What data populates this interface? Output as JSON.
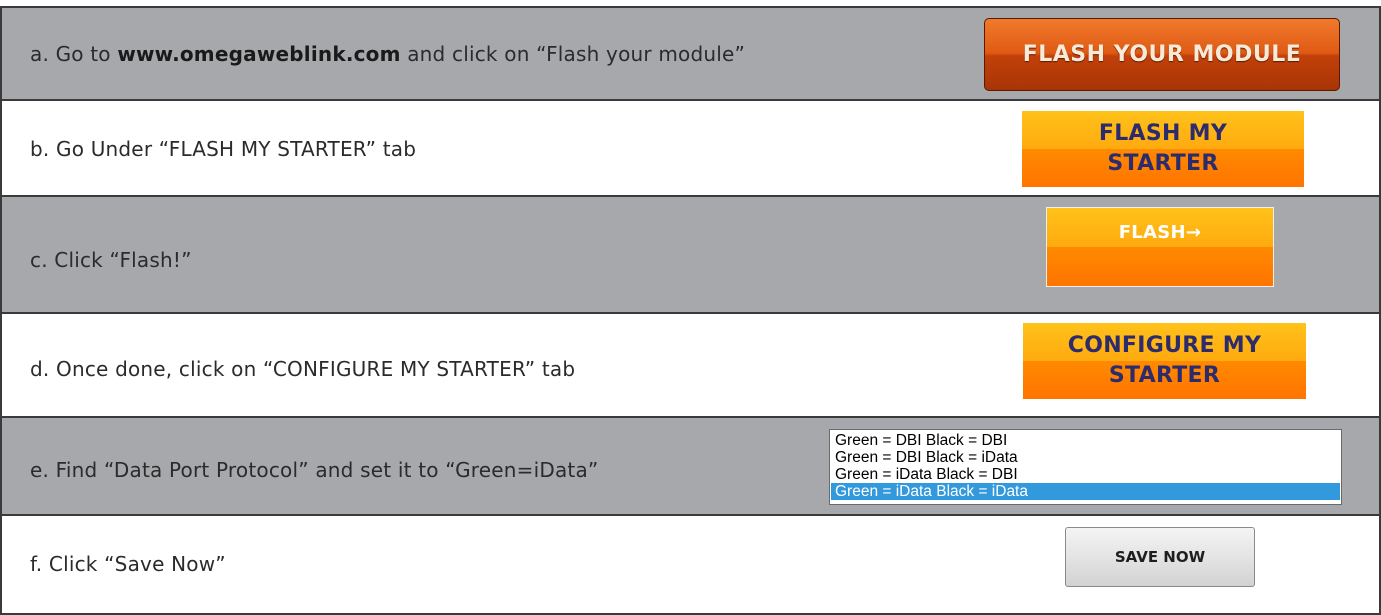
{
  "steps": [
    {
      "prefix": "a. Go to ",
      "bold": "www.omegaweblink.com",
      "suffix": " and click on “Flash your module”",
      "button": "FLASH YOUR MODULE"
    },
    {
      "text": "b. Go Under “FLASH MY STARTER” tab",
      "button_line1": "FLASH MY",
      "button_line2": "STARTER"
    },
    {
      "text": "c. Click “Flash!”",
      "button": "FLASH→"
    },
    {
      "text": "d. Once done, click on “CONFIGURE MY STARTER” tab",
      "button_line1": "CONFIGURE MY",
      "button_line2": "STARTER"
    },
    {
      "text": "e. Find “Data Port Protocol” and set it to “Green=iData”",
      "options": [
        "Green = DBI Black = DBI",
        "Green = DBI Black = iData",
        "Green = iData Black = DBI",
        "Green = iData Black = iData"
      ],
      "selected": "Green = iData Black = iData"
    },
    {
      "text": "f. Click “Save Now”",
      "button": "SAVE NOW"
    }
  ],
  "colors": {
    "gray_row": "#a6a8ab",
    "white_row": "#ffffff",
    "orange_top": "#ffc21a",
    "orange_bottom": "#ff7400",
    "red_button": "#c2400a",
    "selected_option": "#3399dd"
  }
}
